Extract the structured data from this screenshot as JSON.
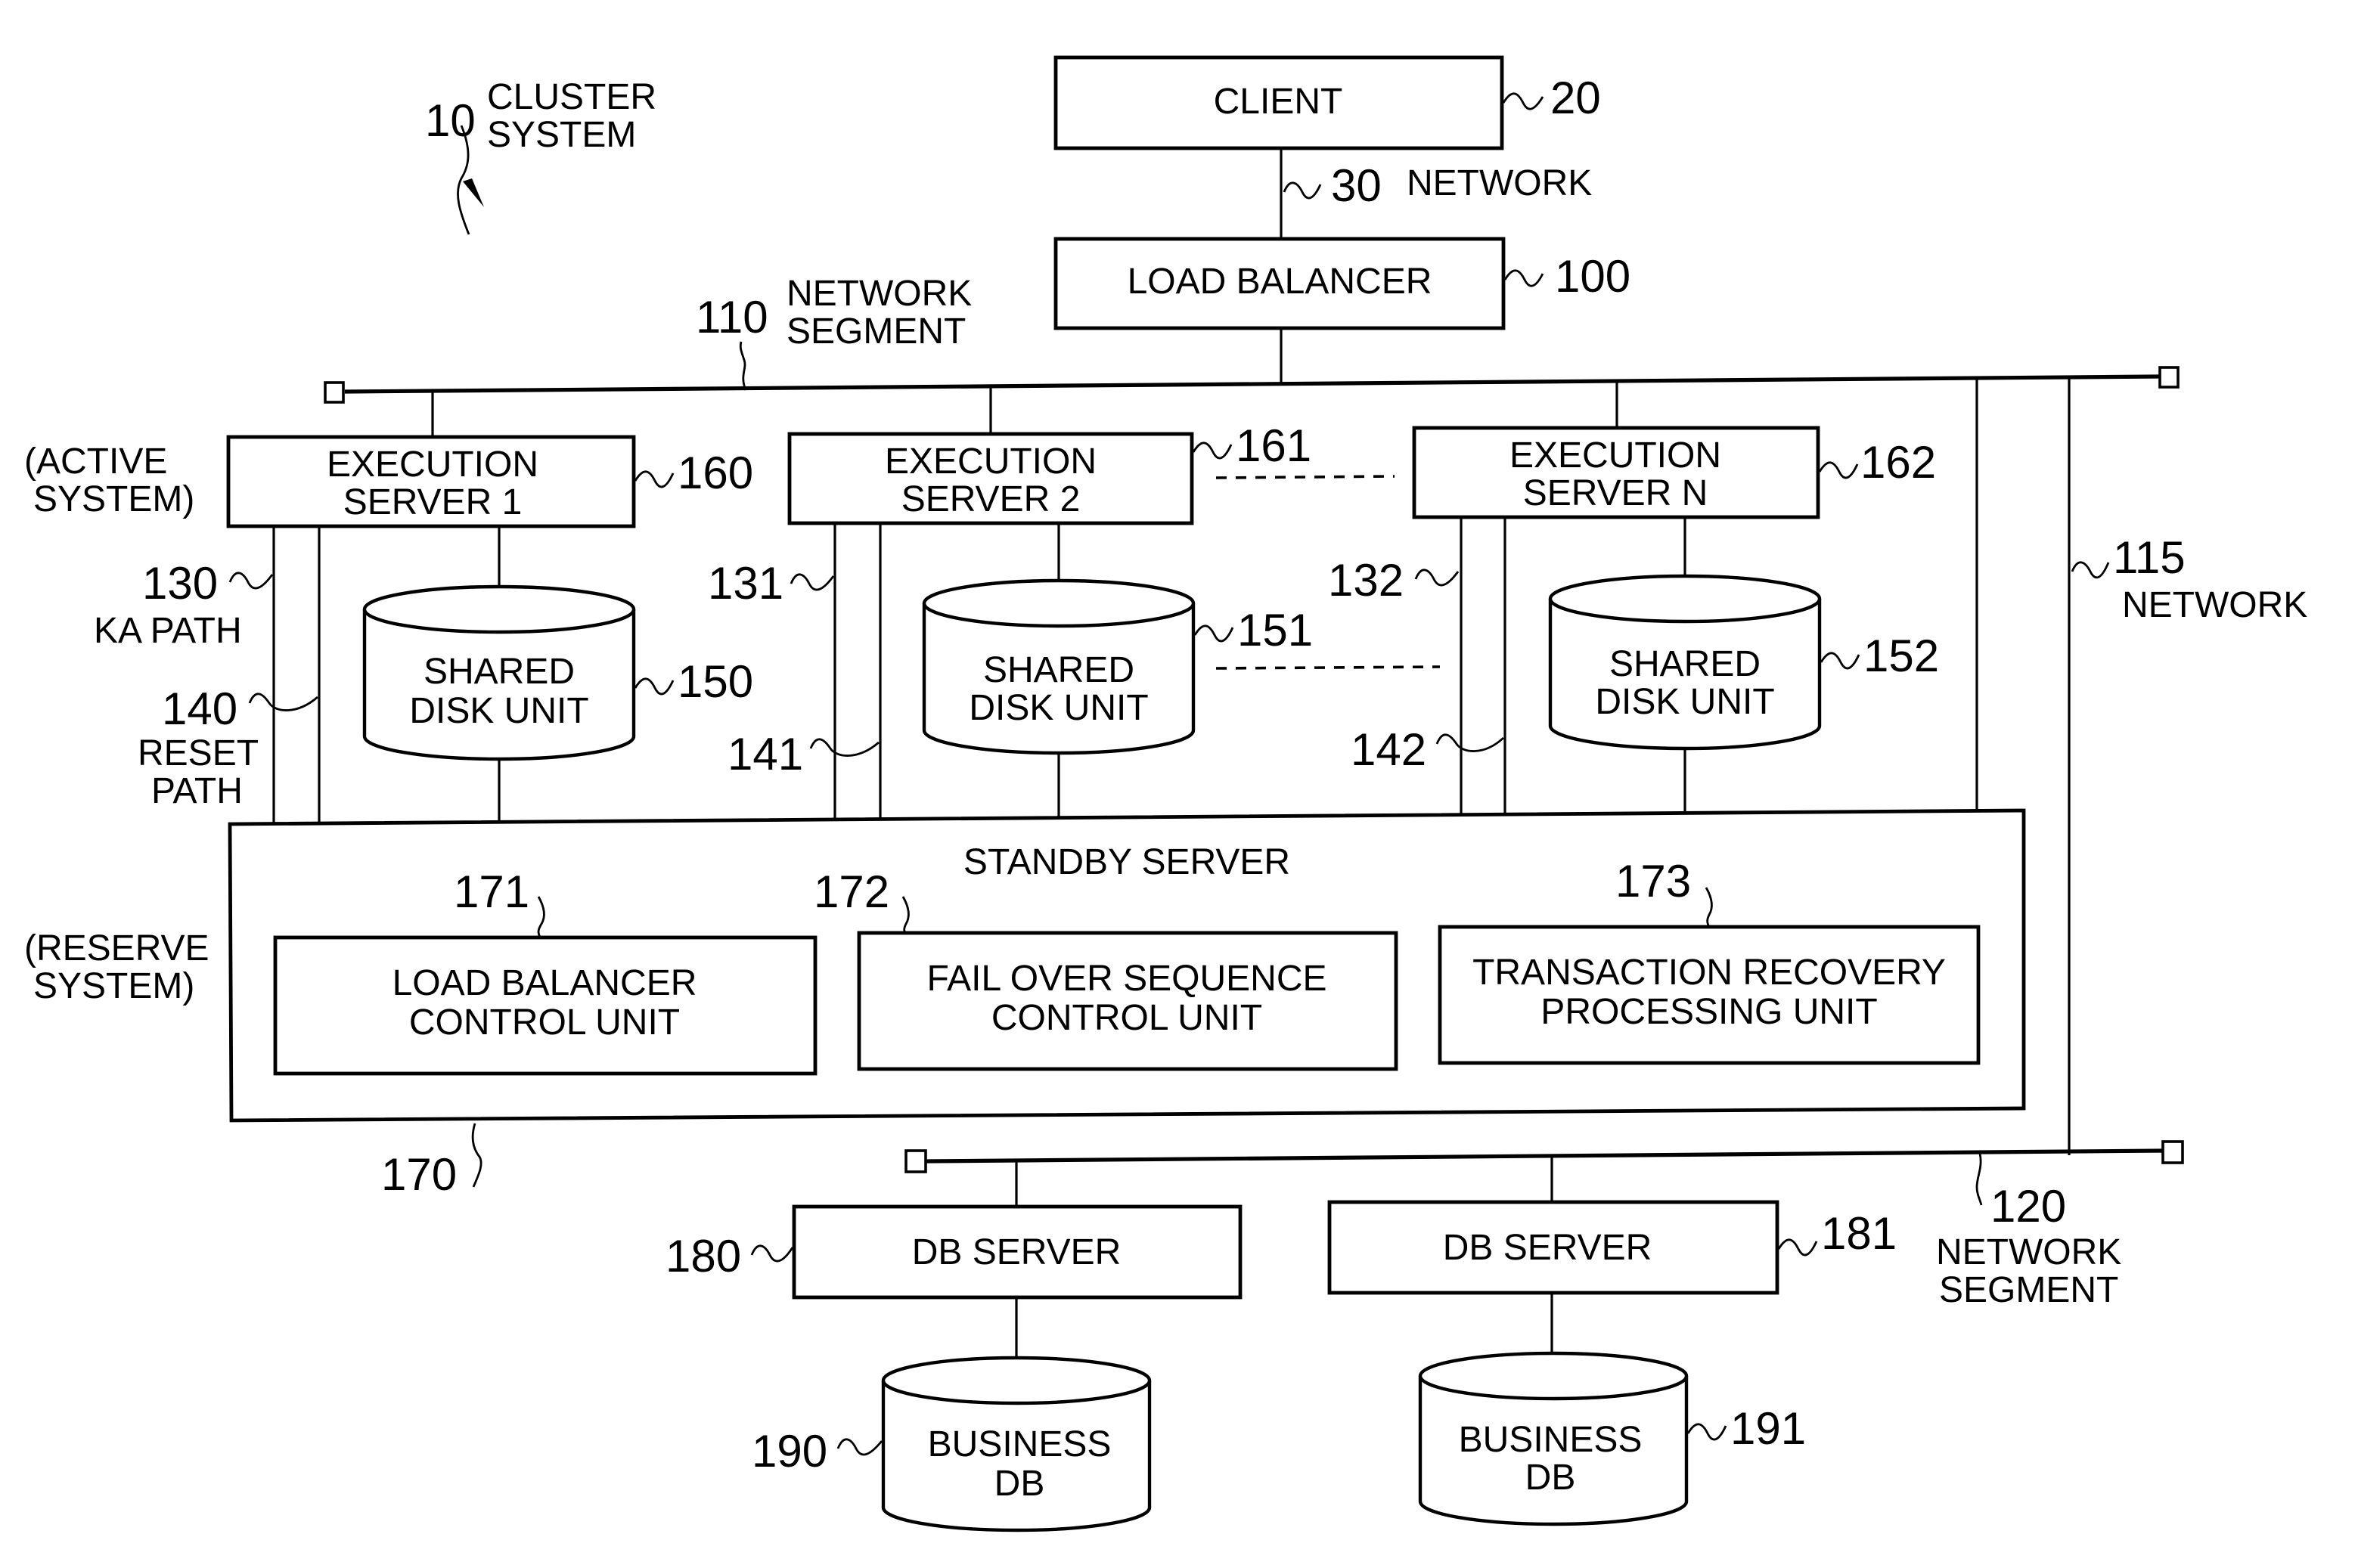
{
  "system": {
    "ref": "10",
    "label_line1": "CLUSTER",
    "label_line2": "SYSTEM"
  },
  "client": {
    "label": "CLIENT",
    "ref": "20"
  },
  "network30": {
    "ref": "30",
    "label": "NETWORK"
  },
  "load_balancer": {
    "label": "LOAD BALANCER",
    "ref": "100"
  },
  "segment110": {
    "ref": "110",
    "label_line1": "NETWORK",
    "label_line2": "SEGMENT"
  },
  "network115": {
    "ref": "115",
    "label": "NETWORK"
  },
  "segment120": {
    "ref": "120",
    "label_line1": "NETWORK",
    "label_line2": "SEGMENT"
  },
  "active_system": {
    "line1": "(ACTIVE",
    "line2": "SYSTEM)"
  },
  "reserve_system": {
    "line1": "(RESERVE",
    "line2": "SYSTEM)"
  },
  "execution_servers": [
    {
      "line1": "EXECUTION",
      "line2": "SERVER 1",
      "ref": "160"
    },
    {
      "line1": "EXECUTION",
      "line2": "SERVER 2",
      "ref": "161"
    },
    {
      "line1": "EXECUTION",
      "line2": "SERVER N",
      "ref": "162"
    }
  ],
  "shared_disks": [
    {
      "line1": "SHARED",
      "line2": "DISK UNIT",
      "ref": "150"
    },
    {
      "line1": "SHARED",
      "line2": "DISK UNIT",
      "ref": "151"
    },
    {
      "line1": "SHARED",
      "line2": "DISK UNIT",
      "ref": "152"
    }
  ],
  "ka_paths": [
    {
      "ref": "130",
      "label": "KA PATH"
    },
    {
      "ref": "131"
    },
    {
      "ref": "132"
    }
  ],
  "reset_paths": [
    {
      "ref": "140",
      "label_line1": "RESET",
      "label_line2": "PATH"
    },
    {
      "ref": "141"
    },
    {
      "ref": "142"
    }
  ],
  "standby_server": {
    "label": "STANDBY SERVER",
    "ref": "170",
    "units": [
      {
        "line1": "LOAD BALANCER",
        "line2": "CONTROL UNIT",
        "ref": "171"
      },
      {
        "line1": "FAIL OVER SEQUENCE",
        "line2": "CONTROL UNIT",
        "ref": "172"
      },
      {
        "line1": "TRANSACTION RECOVERY",
        "line2": "PROCESSING UNIT",
        "ref": "173"
      }
    ]
  },
  "db_servers": [
    {
      "label": "DB SERVER",
      "ref": "180"
    },
    {
      "label": "DB SERVER",
      "ref": "181"
    }
  ],
  "business_dbs": [
    {
      "line1": "BUSINESS",
      "line2": "DB",
      "ref": "190"
    },
    {
      "line1": "BUSINESS",
      "line2": "DB",
      "ref": "191"
    }
  ]
}
